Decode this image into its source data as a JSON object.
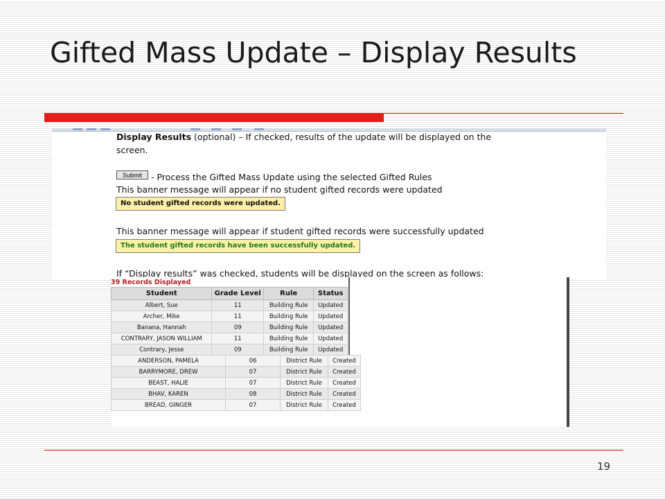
{
  "slide": {
    "title": "Gifted Mass Update – Display Results",
    "page_number": "19"
  },
  "instructions": {
    "display_results_label": "Display Results",
    "display_results_text": " (optional) – If checked, results of the update will be displayed on the",
    "display_results_text_2": "screen.",
    "submit_button": "Submit",
    "submit_text": " - Process the Gifted Mass Update using the selected Gifted Rules",
    "banner_none_intro": "This banner message will appear if no student gifted records were updated",
    "banner_none": "No student gifted records were updated.",
    "banner_success_intro": "This banner message will appear if student gifted records were successfully updated",
    "banner_success": "The student gifted records have been successfully updated.",
    "display_intro": "If “Display results” was checked, students will be displayed on the screen as follows:"
  },
  "colors": {
    "accent_red": "#e31c1c",
    "banner_none_text": "#111111",
    "banner_success_text": "#1a7a1a",
    "records_title": "#b32121"
  },
  "results": {
    "records_label": "39 Records Displayed",
    "headers": [
      "Student",
      "Grade Level",
      "Rule",
      "Status"
    ],
    "rows_a": [
      [
        "Albert, Sue",
        "11",
        "Building Rule",
        "Updated"
      ],
      [
        "Archer, Mike",
        "11",
        "Building Rule",
        "Updated"
      ],
      [
        "Banana, Hannah",
        "09",
        "Building Rule",
        "Updated"
      ],
      [
        "CONTRARY, JASON WILLIAM",
        "11",
        "Building Rule",
        "Updated"
      ],
      [
        "Contrary, Jesse",
        "09",
        "Building Rule",
        "Updated"
      ]
    ],
    "rows_b": [
      [
        "ANDERSON, PAMELA",
        "06",
        "District Rule",
        "Created"
      ],
      [
        "BARRYMORE, DREW",
        "07",
        "District Rule",
        "Created"
      ],
      [
        "BEAST, HALIE",
        "07",
        "District Rule",
        "Created"
      ],
      [
        "BHAV, KAREN",
        "08",
        "District Rule",
        "Created"
      ],
      [
        "BREAD, GINGER",
        "07",
        "District Rule",
        "Created"
      ]
    ]
  }
}
